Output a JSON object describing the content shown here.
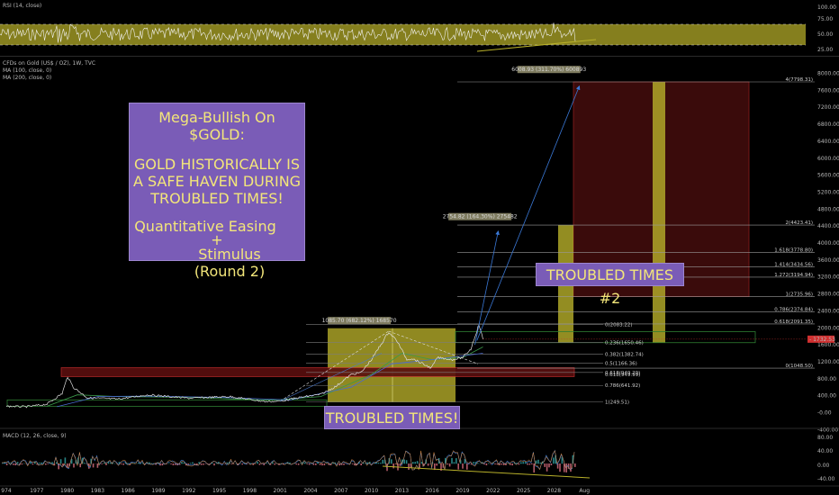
{
  "chart_data": {
    "type": "line",
    "title": "CFDs on Gold (US$ / OZ), 1W, TVC",
    "indicators": [
      "MA (100, close, 0)",
      "MA (200, close, 0)"
    ],
    "price_axis": [
      "8000.00",
      "7600.00",
      "7200.00",
      "6800.00",
      "6400.00",
      "6000.00",
      "5600.00",
      "5200.00",
      "4800.00",
      "4400.00",
      "4000.00",
      "3600.00",
      "3200.00",
      "2800.00",
      "2400.00",
      "2000.00",
      "1600.00",
      "1200.00",
      "800.00",
      "400.00",
      "-0.00",
      "-400.00"
    ],
    "current_price": "1732.53",
    "x_ticks": [
      "974",
      "1977",
      "1980",
      "1983",
      "1986",
      "1989",
      "1992",
      "1995",
      "1998",
      "2001",
      "2004",
      "2007",
      "2010",
      "2013",
      "2016",
      "2019",
      "2022",
      "2025",
      "2028",
      "Aug"
    ],
    "series": [
      {
        "x": [
          1974,
          1976,
          1978,
          1979.5,
          1980.05,
          1980.6,
          1982,
          1985,
          1988,
          1992,
          1996,
          1999.5,
          2001,
          2003,
          2005,
          2006.5,
          2008,
          2009,
          2010,
          2011.7,
          2012.5,
          2013.5,
          2014,
          2015.9,
          2016.5,
          2018,
          2019,
          2019.8,
          2020.6,
          2021
        ],
        "y": [
          150,
          140,
          200,
          450,
          850,
          600,
          350,
          320,
          420,
          340,
          380,
          260,
          270,
          360,
          430,
          620,
          900,
          950,
          1250,
          1900,
          1700,
          1250,
          1280,
          1050,
          1300,
          1250,
          1300,
          1500,
          2080,
          1732
        ]
      }
    ],
    "fib_levels_1": [
      {
        "label": "1(249.51)",
        "y": 249.51
      },
      {
        "label": "0.786(641.92)",
        "y": 641.92
      },
      {
        "label": "0.618(949.29)",
        "y": 949.29
      },
      {
        "label": "0.5(1166.36)",
        "y": 1166.36
      },
      {
        "label": "0.382(1382.74)",
        "y": 1382.74
      },
      {
        "label": "0.236(1650.46)",
        "y": 1650.46
      },
      {
        "label": "0(2083.22)",
        "y": 2083.22
      }
    ],
    "fib_levels_2": [
      {
        "label": "0(1048.50)",
        "y": 1048.5
      },
      {
        "label": "0.618(2091.35)",
        "y": 2091.35
      },
      {
        "label": "0.786(2374.84)",
        "y": 2374.84
      },
      {
        "label": "1(2735.96)",
        "y": 2735.96
      },
      {
        "label": "1.272(3194.94)",
        "y": 3194.94
      },
      {
        "label": "1.414(3434.56)",
        "y": 3434.56
      },
      {
        "label": "1.618(3778.80)",
        "y": 3778.8
      },
      {
        "label": "2(4423.41)",
        "y": 4423.41
      },
      {
        "label": "4(7798.31)",
        "y": 7798.31
      }
    ],
    "extra_fib": {
      "label": "0.618(949.99)",
      "y": 900
    },
    "price_tags": [
      {
        "label": "1085.70 (682.12%) 168570",
        "x": 2008.8,
        "y": 2150
      },
      {
        "label": "2754.82 (164.30%) 275482",
        "x": 2020.7,
        "y": 4600
      },
      {
        "label": "6008.93 (311.70%) 600893",
        "x": 2027.5,
        "y": 8070
      }
    ],
    "rsi": {
      "title": "RSI (14, close)",
      "axis": [
        "100.00",
        "75.00",
        "50.00",
        "25.00"
      ],
      "upper": 70,
      "lower": 30
    },
    "macd": {
      "title": "MACD (12, 26, close, 9)",
      "axis": [
        "80.00",
        "40.00",
        "0.00",
        "-40.00"
      ]
    }
  },
  "notes": {
    "main_title": "Mega-Bullish On $GOLD:",
    "lines": [
      "GOLD HISTORICALLY IS",
      "A SAFE HAVEN DURING",
      "TROUBLED TIMES!"
    ],
    "qe": "Quantitative Easing",
    "plus": "+",
    "stimulus": "Stimulus",
    "round": "(Round 2)",
    "troubled": "TROUBLED TIMES!",
    "troubled2": "TROUBLED TIMES #2"
  },
  "colors": {
    "gold": "#b8b02a",
    "purple": "#7a5cb7",
    "note_text": "#f3e67a",
    "price_line": "#e0e0e0",
    "ma": "#3a9a4a",
    "arrow": "#3a78d6",
    "red": "#d03030",
    "macd": "#3d7fd8"
  }
}
